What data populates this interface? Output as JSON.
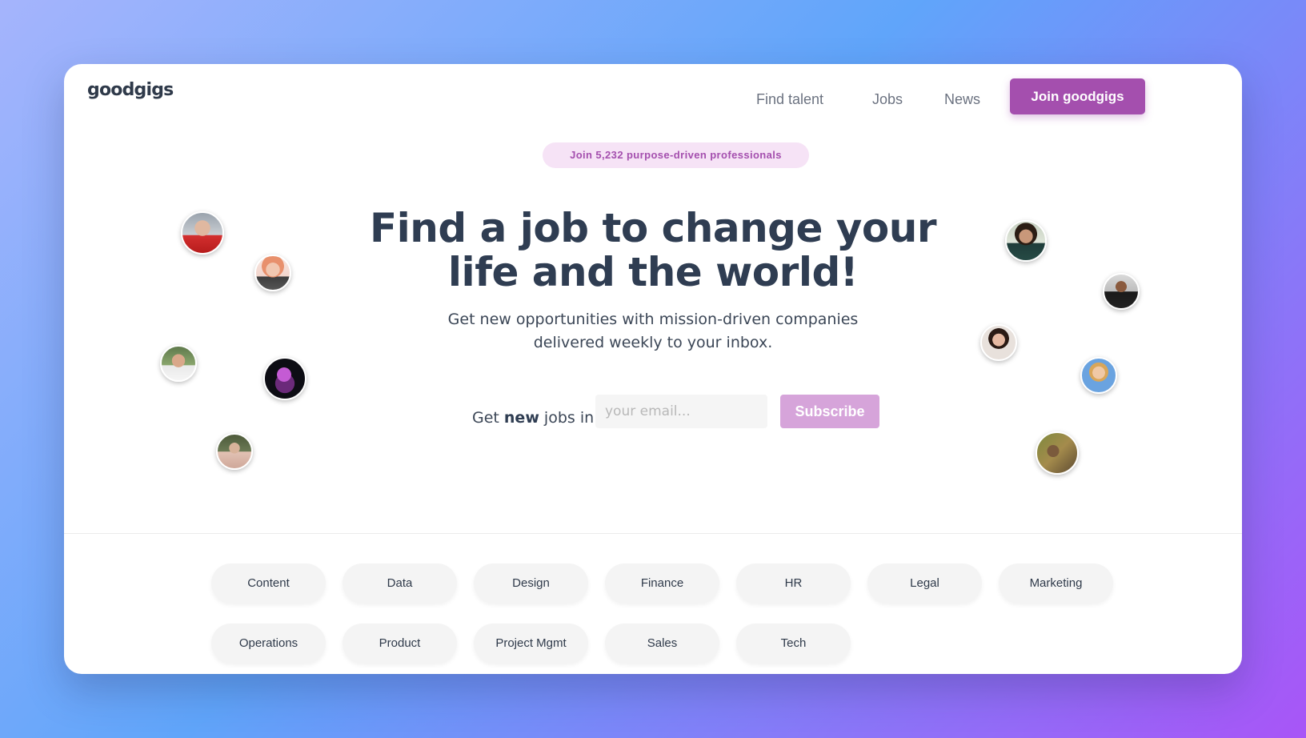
{
  "header": {
    "logo": "goodgigs",
    "nav": [
      "Find talent",
      "Jobs",
      "News"
    ],
    "cta": "Join goodgigs"
  },
  "badge": "Join 5,232 purpose-driven professionals",
  "hero": {
    "title_line1": "Find a job to change your",
    "title_line2": "life and the world!",
    "subtitle_line1": "Get new opportunities with mission-driven companies",
    "subtitle_line2": "delivered weekly to your inbox."
  },
  "subscribe": {
    "prefix_before": "Get ",
    "prefix_bold": "new",
    "prefix_after": " jobs in",
    "placeholder": "your email...",
    "button": "Subscribe"
  },
  "categories": [
    "Content",
    "Data",
    "Design",
    "Finance",
    "HR",
    "Legal",
    "Marketing",
    "Operations",
    "Product",
    "Project Mgmt",
    "Sales",
    "Tech"
  ],
  "colors": {
    "accent": "#a44fae",
    "accent_light": "#d6a4da",
    "badge_bg": "#f6e3f6",
    "heading": "#2f3d52"
  }
}
